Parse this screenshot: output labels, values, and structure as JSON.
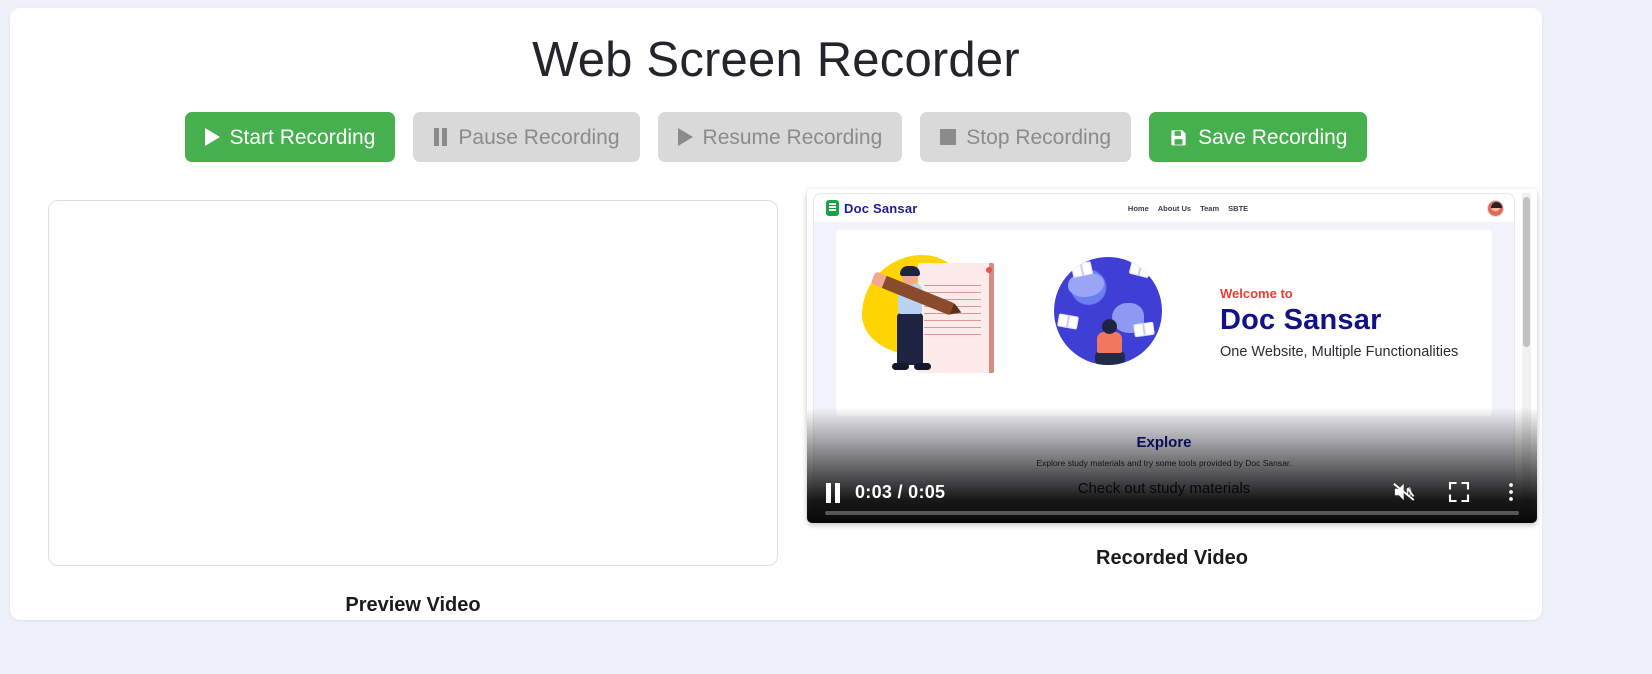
{
  "header": {
    "title": "Web Screen Recorder"
  },
  "toolbar": {
    "start": {
      "label": "Start Recording",
      "icon": "play-icon",
      "state": "enabled",
      "color": "#45b04d"
    },
    "pause": {
      "label": "Pause Recording",
      "icon": "pause-icon",
      "state": "disabled",
      "color": "#d9d9d9"
    },
    "resume": {
      "label": "Resume Recording",
      "icon": "play-icon",
      "state": "disabled",
      "color": "#d9d9d9"
    },
    "stop": {
      "label": "Stop Recording",
      "icon": "stop-icon",
      "state": "disabled",
      "color": "#d9d9d9"
    },
    "save": {
      "label": "Save Recording",
      "icon": "save-floppy-icon",
      "state": "enabled",
      "color": "#45b04d"
    }
  },
  "panels": {
    "preview": {
      "label": "Preview Video",
      "content": ""
    },
    "recorded": {
      "label": "Recorded Video"
    }
  },
  "video": {
    "current_time": "0:03",
    "duration": "0:05",
    "time_display": "0:03 / 0:05",
    "progress_percent": 65,
    "play_state": "playing",
    "muted": true,
    "controls": {
      "pause": "pause-icon",
      "mute": "volume-muted-icon",
      "fullscreen": "fullscreen-icon",
      "more": "more-vertical-icon"
    }
  },
  "captured_page": {
    "brand": "Doc Sansar",
    "logo": "doc-sansar-logo",
    "nav": [
      "Home",
      "About Us",
      "Team",
      "SBTE"
    ],
    "avatar": "user-avatar",
    "hero": {
      "eyebrow": "Welcome to",
      "title": "Doc Sansar",
      "tagline": "One Website, Multiple Functionalities",
      "eyebrow_color": "#ef3b30",
      "title_color": "#121287"
    },
    "explore": {
      "title": "Explore",
      "subtitle": "Explore study materials and try some tools provided by Doc Sansar.",
      "heading2": "Check out study materials"
    }
  }
}
